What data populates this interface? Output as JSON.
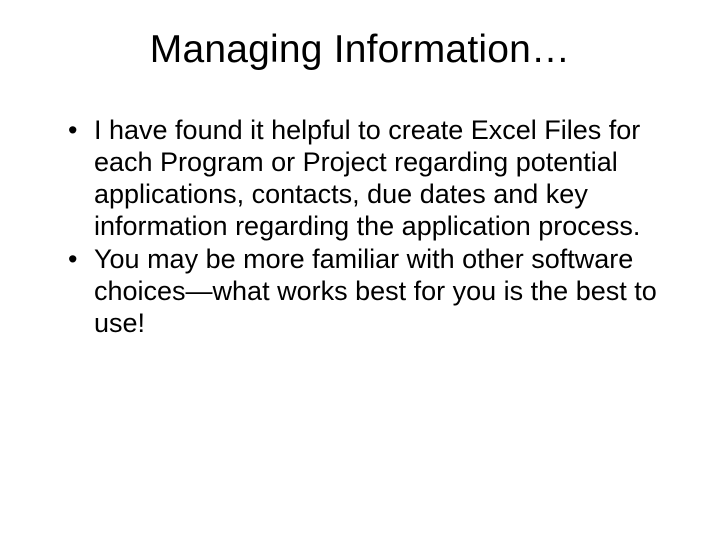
{
  "slide": {
    "title": "Managing Information…",
    "bullets": [
      "I have found it helpful to create Excel Files for each Program or Project regarding potential applications, contacts, due dates and key information regarding the application process.",
      "You may be more familiar with other software choices—what works best for you is the best to use!"
    ]
  }
}
